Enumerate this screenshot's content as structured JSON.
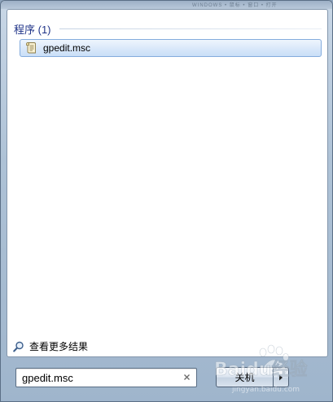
{
  "titlebar": {
    "blurred_text": "WINDOWS • 鼠标 • 窗口 • 打开"
  },
  "results": {
    "section_title": "程序 (1)",
    "items": [
      {
        "label": "gpedit.msc",
        "icon": "script-file-icon"
      }
    ],
    "see_more_label": "查看更多结果",
    "see_more_icon": "search-icon"
  },
  "search": {
    "value": "gpedit.msc",
    "clear_icon": "close-icon"
  },
  "shutdown": {
    "label": "关机",
    "arrow_icon": "chevron-right-icon"
  },
  "watermark": {
    "text": "Baidu经验",
    "subtext": "jingyan.baidu.com"
  },
  "colors": {
    "section_title": "#1e3287",
    "selection_border": "#84acdd",
    "frame": "#aec2d6"
  }
}
